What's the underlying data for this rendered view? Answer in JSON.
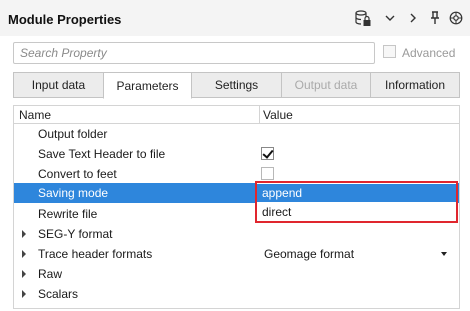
{
  "header": {
    "title": "Module Properties",
    "icons": [
      "database-lock-icon",
      "chevron-down-icon",
      "chevron-right-icon",
      "pin-icon",
      "help-icon"
    ]
  },
  "search": {
    "placeholder": "Search Property",
    "value": ""
  },
  "advanced": {
    "label": "Advanced",
    "checked": false,
    "enabled": false
  },
  "tabs": [
    {
      "label": "Input data",
      "active": false,
      "enabled": true
    },
    {
      "label": "Parameters",
      "active": true,
      "enabled": true
    },
    {
      "label": "Settings",
      "active": false,
      "enabled": true
    },
    {
      "label": "Output data",
      "active": false,
      "enabled": false
    },
    {
      "label": "Information",
      "active": false,
      "enabled": true
    }
  ],
  "grid": {
    "columns": [
      "Name",
      "Value"
    ],
    "rows": [
      {
        "name": "Output folder",
        "value": "",
        "type": "text"
      },
      {
        "name": "Save Text Header to file",
        "value": true,
        "type": "checkbox"
      },
      {
        "name": "Convert to feet",
        "value": false,
        "type": "checkbox"
      },
      {
        "name": "Saving mode",
        "value": "append",
        "type": "combo",
        "selected": true
      },
      {
        "name": "Rewrite file",
        "value": "",
        "type": "text"
      },
      {
        "name": "SEG-Y format",
        "value": "",
        "type": "group"
      },
      {
        "name": "Trace header formats",
        "value": "Geomage format",
        "type": "group-combo"
      },
      {
        "name": "Raw",
        "value": "",
        "type": "group"
      },
      {
        "name": "Scalars",
        "value": "",
        "type": "group"
      }
    ]
  },
  "dropdown": {
    "options": [
      "append",
      "direct"
    ],
    "highlighted": "append",
    "outline_color": "#e0262e"
  },
  "colors": {
    "selection": "#2e86dc",
    "highlight_outline": "#e0262e"
  }
}
